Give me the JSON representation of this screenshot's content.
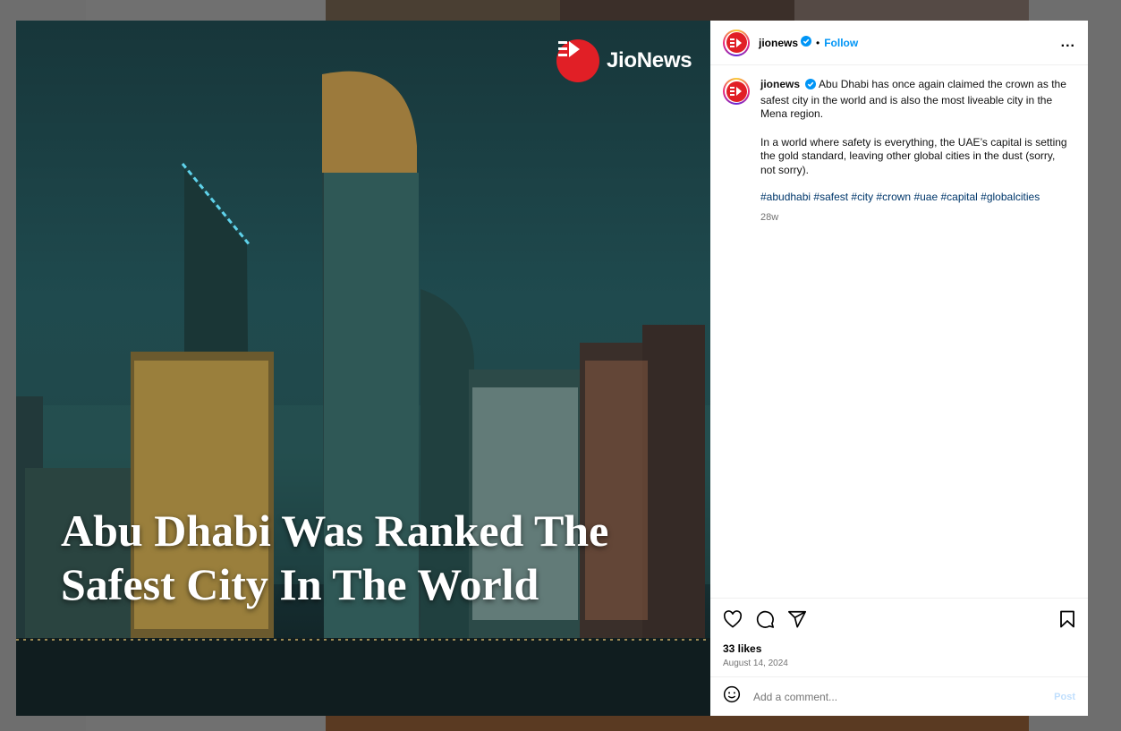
{
  "post": {
    "brand_logo_text": "JioNews",
    "headline": "Abu Dhabi Was Ranked The Safest City In The World",
    "brand_color": "#e11f26"
  },
  "header": {
    "username": "jionews",
    "verified_icon": "verified-badge-icon",
    "separator": "•",
    "follow_label": "Follow",
    "more_label": "..."
  },
  "caption": {
    "username": "jionews",
    "paragraph1": "Abu Dhabi has once again claimed the crown as the safest city in the world and is also the most liveable city in the Mena region.",
    "paragraph2": "In a world where safety is everything, the UAE’s capital is setting the gold standard, leaving other global cities in the dust (sorry, not sorry).",
    "hashtags": "#abudhabi #safest #city #crown #uae #capital #globalcities",
    "age": "28w"
  },
  "actions": {
    "icons": [
      "heart-icon",
      "comment-icon",
      "share-icon",
      "bookmark-icon"
    ],
    "likes": "33 likes",
    "date": "August 14, 2024"
  },
  "comment_bar": {
    "emoji_icon": "emoji-icon",
    "placeholder": "Add a comment...",
    "post_label": "Post"
  },
  "colors": {
    "link_blue": "#0095f6",
    "hashtag": "#00376b",
    "muted": "#737373"
  }
}
